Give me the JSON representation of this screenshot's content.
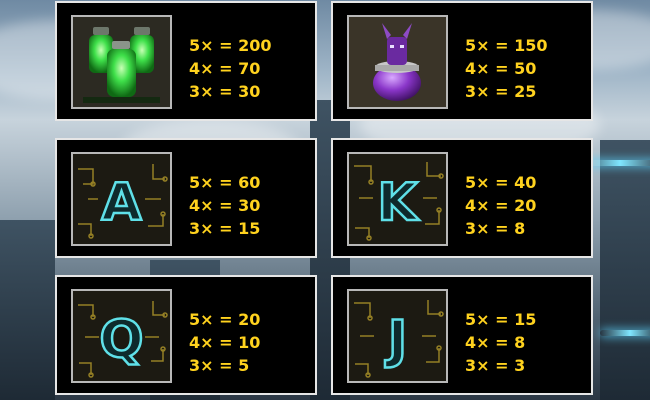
{
  "paytable": [
    {
      "symbol": "green-potion-jars-icon",
      "pays": [
        "5× = 200",
        "4× = 70",
        "3× = 30"
      ]
    },
    {
      "symbol": "purple-canopic-jar-icon",
      "pays": [
        "5× = 150",
        "4× = 50",
        "3× = 25"
      ]
    },
    {
      "symbol": "letter-a-circuit-icon",
      "letter": "A",
      "pays": [
        "5× = 60",
        "4× = 30",
        "3× = 15"
      ]
    },
    {
      "symbol": "letter-k-circuit-icon",
      "letter": "K",
      "pays": [
        "5× = 40",
        "4× = 20",
        "3× = 8"
      ]
    },
    {
      "symbol": "letter-q-circuit-icon",
      "letter": "Q",
      "pays": [
        "5× = 20",
        "4× = 10",
        "3× = 5"
      ]
    },
    {
      "symbol": "letter-j-circuit-icon",
      "letter": "J",
      "pays": [
        "5× = 15",
        "4× = 8",
        "3× = 3"
      ]
    }
  ],
  "colors": {
    "payout_text": "#ffd21e",
    "panel_background": "#000000",
    "panel_border": "#e6e6e6",
    "neon_letter": "#5fe0e8",
    "circuit_gold": "#b49a2a"
  }
}
